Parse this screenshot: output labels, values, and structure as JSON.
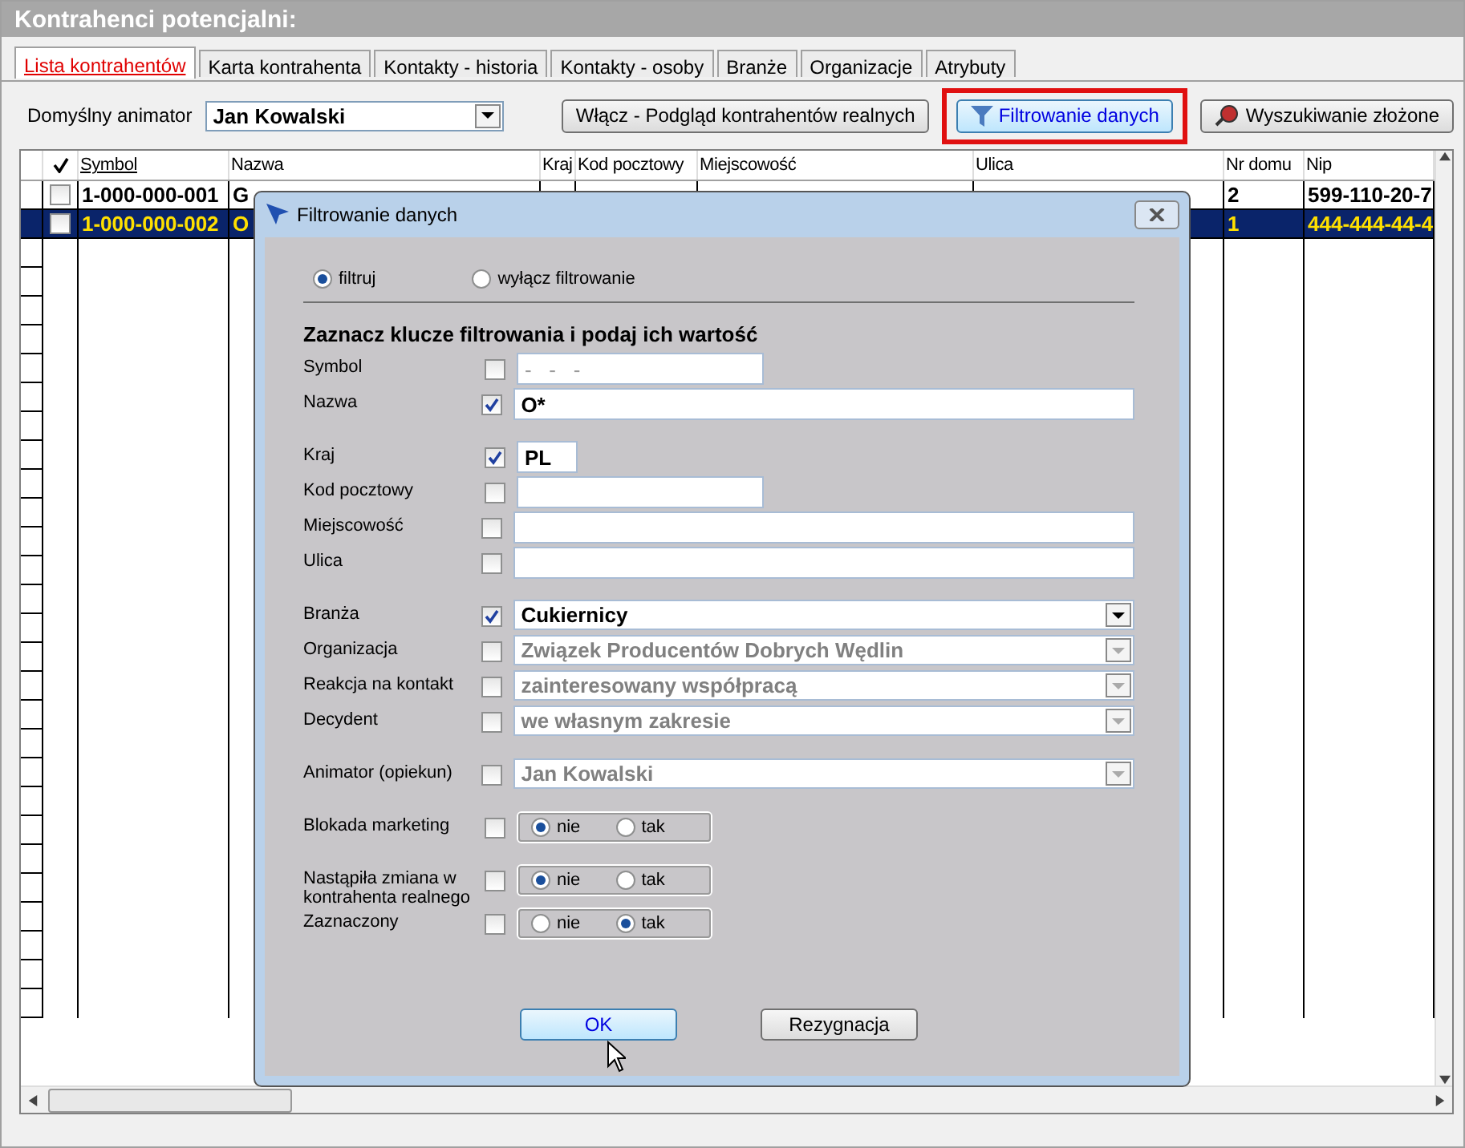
{
  "window": {
    "title": "Kontrahenci potencjalni:"
  },
  "tabs": [
    {
      "label": "Lista kontrahentów",
      "selected": true
    },
    {
      "label": "Karta kontrahenta",
      "selected": false
    },
    {
      "label": "Kontakty - historia",
      "selected": false
    },
    {
      "label": "Kontakty - osoby",
      "selected": false
    },
    {
      "label": "Branże",
      "selected": false
    },
    {
      "label": "Organizacje",
      "selected": false
    },
    {
      "label": "Atrybuty",
      "selected": false
    }
  ],
  "toolbar": {
    "animator_label": "Domyślny animator",
    "animator_value": "Jan Kowalski",
    "buttons": [
      {
        "label": "Włącz - Podgląd kontrahentów realnych",
        "highlighted": false,
        "kind": "plain"
      },
      {
        "label": "Filtrowanie danych",
        "highlighted": true,
        "kind": "filter"
      },
      {
        "label": "Wyszukiwanie złożone",
        "highlighted": false,
        "kind": "search"
      }
    ]
  },
  "table": {
    "columns": [
      "Symbol",
      "Nazwa",
      "Kraj",
      "Kod pocztowy",
      "Miejscowość",
      "Ulica",
      "Nr domu",
      "Nip"
    ],
    "rows": [
      {
        "selected": false,
        "checked": false,
        "cells": [
          "1-000-000-001",
          "G",
          "",
          "",
          "",
          "",
          "2",
          "599-110-20-7"
        ]
      },
      {
        "selected": true,
        "checked": false,
        "cells": [
          "1-000-000-002",
          "O",
          "",
          "",
          "",
          "",
          "1",
          "444-444-44-4"
        ]
      }
    ]
  },
  "dialog": {
    "title": "Filtrowanie danych",
    "mode": [
      {
        "label": "filtruj",
        "selected": true
      },
      {
        "label": "wyłącz filtrowanie",
        "selected": false
      }
    ],
    "heading": "Zaznacz klucze filtrowania i podaj ich wartość",
    "groups": [
      [
        {
          "label": "Symbol",
          "checked": false,
          "kind": "medium",
          "mask": "-   -   -"
        },
        {
          "label": "Nazwa",
          "checked": true,
          "kind": "wide",
          "value": "O*"
        }
      ],
      [
        {
          "label": "Kraj",
          "checked": true,
          "kind": "short",
          "value": "PL"
        },
        {
          "label": "Kod pocztowy",
          "checked": false,
          "kind": "medium"
        },
        {
          "label": "Miejscowość",
          "checked": false,
          "kind": "wide"
        },
        {
          "label": "Ulica",
          "checked": false,
          "kind": "wide"
        }
      ],
      [
        {
          "label": "Branża",
          "checked": true,
          "kind": "combo",
          "value": "Cukiernicy",
          "disabled": false
        },
        {
          "label": "Organizacja",
          "checked": false,
          "kind": "combo",
          "value": "Związek Producentów Dobrych Wędlin",
          "disabled": true
        },
        {
          "label": "Reakcja na kontakt",
          "checked": false,
          "kind": "combo",
          "value": "zainteresowany współpracą",
          "disabled": true
        },
        {
          "label": "Decydent",
          "checked": false,
          "kind": "combo",
          "value": "we własnym zakresie",
          "disabled": true
        }
      ],
      [
        {
          "label": "Animator (opiekun)",
          "checked": false,
          "kind": "combo",
          "value": "Jan Kowalski",
          "disabled": true
        }
      ],
      [
        {
          "label": "Blokada marketing",
          "checked": false,
          "kind": "choice",
          "options": [
            {
              "label": "nie",
              "selected": true
            },
            {
              "label": "tak",
              "selected": false
            }
          ]
        }
      ],
      [
        {
          "label": "Nastąpiła zmiana w kontrahenta realnego",
          "checked": false,
          "kind": "choice",
          "options": [
            {
              "label": "nie",
              "selected": true
            },
            {
              "label": "tak",
              "selected": false
            }
          ]
        },
        {
          "label": "Zaznaczony",
          "checked": false,
          "kind": "choice",
          "options": [
            {
              "label": "nie",
              "selected": false
            },
            {
              "label": "tak",
              "selected": true
            }
          ]
        }
      ]
    ],
    "buttons": [
      {
        "label": "OK",
        "focused": true
      },
      {
        "label": "Rezygnacja",
        "focused": false
      }
    ]
  }
}
